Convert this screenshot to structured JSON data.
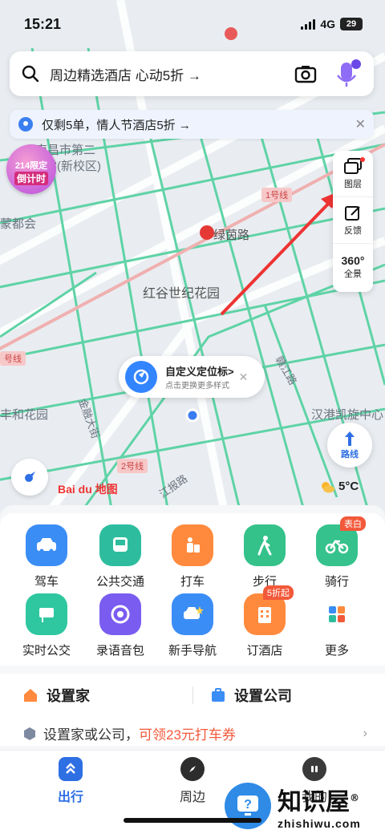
{
  "status_bar": {
    "time": "15:21",
    "network": "4G",
    "battery": "29"
  },
  "search": {
    "placeholder": "周边精选酒店 心动5折 →"
  },
  "promo_banner": {
    "text": "仅剩5单，情人节酒店5折 →",
    "close": "✕"
  },
  "countdown_badge": {
    "line1": "214限定",
    "line2": "倒计时"
  },
  "map": {
    "labels": [
      "南昌市第二",
      "学(新校区)",
      "绿茵路",
      "红谷世纪花园",
      "丰和花园",
      "汉港凯旋中心",
      "金融大街",
      "江报路",
      "赣江路",
      "蒙都会",
      "1号线",
      "2号线",
      "号线"
    ],
    "locator": {
      "title": "自定义定位标>",
      "subtitle": "点击更换更多样式",
      "close": "✕"
    },
    "route_label": "路线",
    "baidu_logo": "Bai du 地图",
    "weather": "5°C"
  },
  "tools": [
    {
      "label": "图层",
      "icon": "layers-icon"
    },
    {
      "label": "反馈",
      "icon": "feedback-icon"
    },
    {
      "label": "全景",
      "icon": "panorama-360-icon",
      "glyph": "360°"
    }
  ],
  "quick_actions": [
    {
      "label": "驾车",
      "color": "#3b8df6"
    },
    {
      "label": "公共交通",
      "color": "#2dbd9e"
    },
    {
      "label": "打车",
      "color": "#ff8a3d"
    },
    {
      "label": "步行",
      "color": "#34c28a"
    },
    {
      "label": "骑行",
      "color": "#35c28c",
      "tag": "表白"
    },
    {
      "label": "实时公交",
      "color": "#2ec7a0"
    },
    {
      "label": "录语音包",
      "color": "#7a5cf0"
    },
    {
      "label": "新手导航",
      "color": "#3b8df6"
    },
    {
      "label": "订酒店",
      "color": "#ff8a3d",
      "tag": "5折起"
    },
    {
      "label": "更多",
      "color": "#ffffff"
    }
  ],
  "home": {
    "home_label": "设置家",
    "company_label": "设置公司",
    "promo_prefix": "设置家或公司，",
    "promo_highlight": "可领23元打车券",
    "arrow": "›"
  },
  "tabs": [
    {
      "label": "出行",
      "active": true
    },
    {
      "label": "周边",
      "active": false
    },
    {
      "label": "我的",
      "active": false
    }
  ],
  "watermark": {
    "title": "知识屋",
    "mark": "®",
    "url": "zhishiwu.com"
  }
}
